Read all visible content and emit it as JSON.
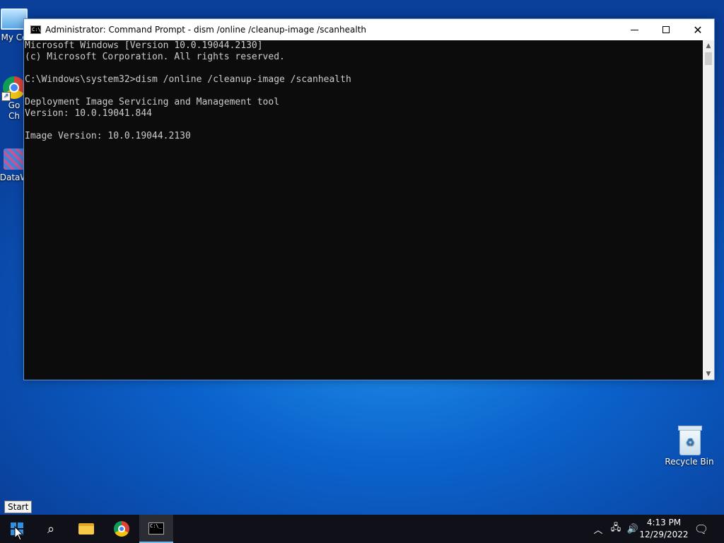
{
  "desktop": {
    "icons": {
      "my_computer": {
        "label": "My Co"
      },
      "chrome": {
        "label_line1": "Go",
        "label_line2": "Ch"
      },
      "dataw": {
        "label": "DataW"
      },
      "recycle_bin": {
        "label": "Recycle Bin"
      }
    }
  },
  "window": {
    "title": "Administrator:  Command Prompt - dism  /online /cleanup-image /scanhealth",
    "console_lines": [
      "Microsoft Windows [Version 10.0.19044.2130]",
      "(c) Microsoft Corporation. All rights reserved.",
      "",
      "C:\\Windows\\system32>dism /online /cleanup-image /scanhealth",
      "",
      "Deployment Image Servicing and Management tool",
      "Version: 10.0.19041.844",
      "",
      "Image Version: 10.0.19044.2130"
    ]
  },
  "taskbar": {
    "start_tooltip": "Start",
    "clock": {
      "time": "4:13 PM",
      "date": "12/29/2022"
    }
  },
  "icons": {
    "start": "windows-logo-icon",
    "search": "search-icon",
    "explorer": "folder-icon",
    "chrome": "chrome-icon",
    "cmd": "command-prompt-icon",
    "tray_chevron": "chevron-up-icon",
    "network": "network-icon",
    "volume": "volume-icon",
    "notifications": "notification-icon"
  },
  "colors": {
    "console_bg": "#0c0c0c",
    "console_text": "#cccccc",
    "taskbar_bg": "#101018",
    "accent": "#2d8fe6"
  }
}
